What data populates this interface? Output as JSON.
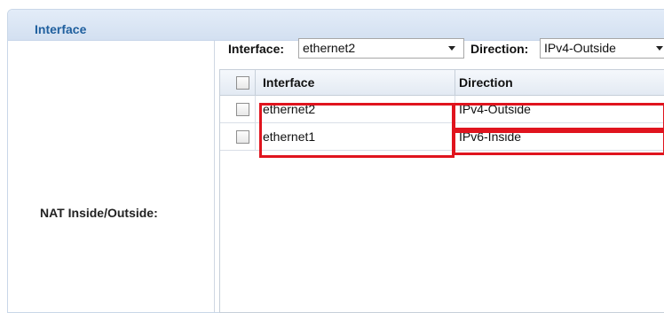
{
  "section": {
    "title": "Interface"
  },
  "field_label": "NAT Inside/Outside:",
  "filters": {
    "interface_label": "Interface:",
    "interface_value": "ethernet2",
    "direction_label": "Direction:",
    "direction_value": "IPv4-Outside"
  },
  "table": {
    "columns": [
      "Interface",
      "Direction"
    ],
    "rows": [
      {
        "interface": "ethernet2",
        "direction": "IPv4-Outside"
      },
      {
        "interface": "ethernet1",
        "direction": "IPv6-Inside"
      }
    ]
  },
  "colors": {
    "header_text": "#1f5f9e",
    "highlight": "#e0141e"
  },
  "icons": {
    "dropdown": "chevron-down-icon",
    "checkbox": "checkbox-unchecked-icon"
  }
}
